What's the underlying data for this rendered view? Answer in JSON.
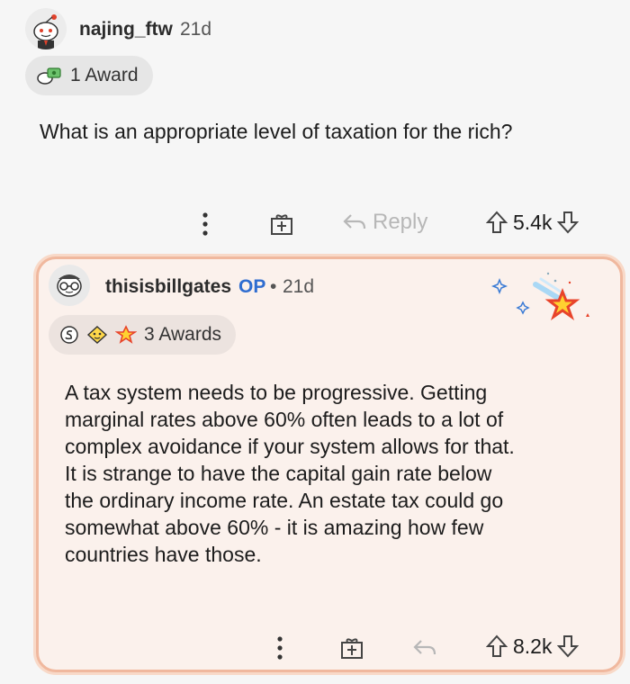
{
  "parent": {
    "username": "najing_ftw",
    "age": "21d",
    "award_label": "1 Award",
    "body": "What is an appropriate level of taxation for the rich?",
    "reply_label": "Reply",
    "score": "5.4k"
  },
  "reply": {
    "username": "thisisbillgates",
    "op_badge": "OP",
    "separator": "•",
    "age": "21d",
    "award_label": "3 Awards",
    "body_lines": [
      "A tax system needs to be progressive. Getting",
      "marginal rates above 60% often leads to a lot of",
      "complex avoidance if your system allows for that.",
      "It is strange to have the capital gain rate below",
      "the ordinary income rate. An estate tax could go",
      "somewhat above 60% - it is amazing how few",
      "countries have those."
    ],
    "score": "8.2k"
  },
  "colors": {
    "op": "#2f6dd0",
    "highlight_border": "#f0b89e",
    "highlight_bg": "#fbf1ec"
  }
}
